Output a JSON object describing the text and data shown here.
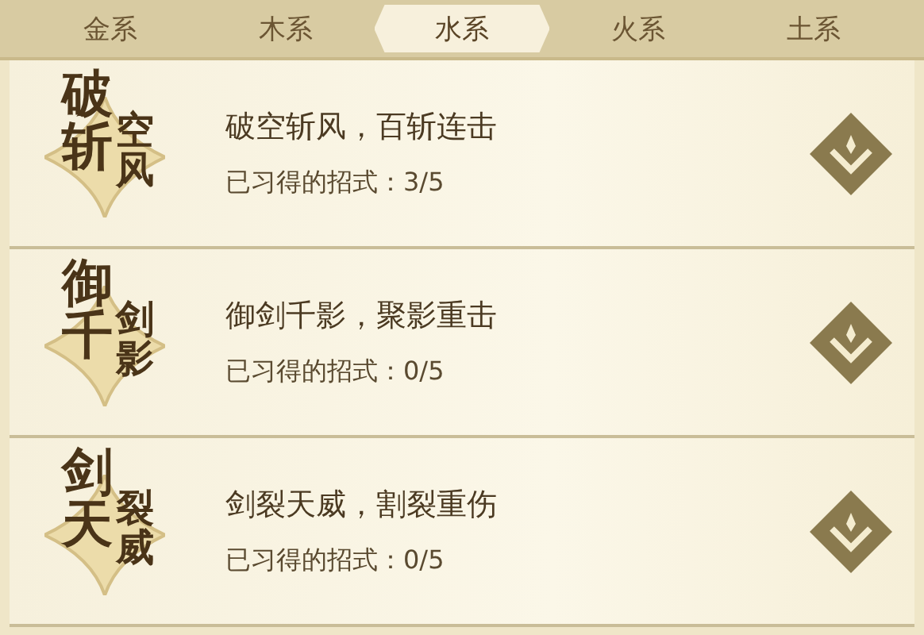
{
  "tabs": [
    {
      "label": "金系",
      "selected": false
    },
    {
      "label": "木系",
      "selected": false
    },
    {
      "label": "水系",
      "selected": true
    },
    {
      "label": "火系",
      "selected": false
    },
    {
      "label": "土系",
      "selected": false
    }
  ],
  "skills": [
    {
      "emblem": [
        "破",
        "斩",
        "空",
        "风"
      ],
      "title": "破空斩风，百斩连击",
      "progress": "已习得的招式：3/5"
    },
    {
      "emblem": [
        "御",
        "千",
        "剑",
        "影"
      ],
      "title": "御剑千影，聚影重击",
      "progress": "已习得的招式：0/5"
    },
    {
      "emblem": [
        "剑",
        "天",
        "裂",
        "威"
      ],
      "title": "剑裂天威，割裂重伤",
      "progress": "已习得的招式：0/5"
    }
  ]
}
